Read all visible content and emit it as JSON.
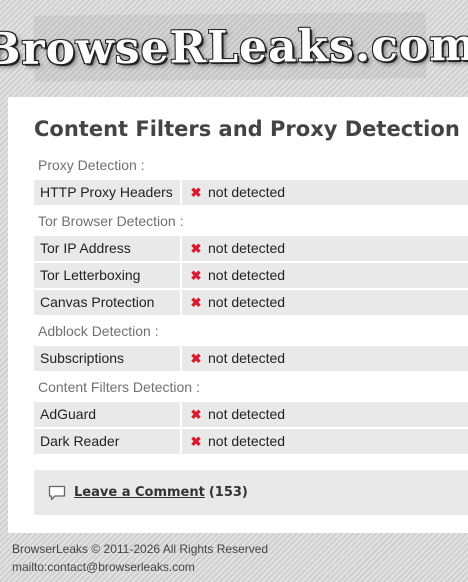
{
  "header": {
    "logo_text": "BrowseRLeaks.com"
  },
  "main": {
    "title": "Content Filters and Proxy Detection",
    "sections": [
      {
        "header": "Proxy Detection :",
        "rows": [
          {
            "label": "HTTP Proxy Headers",
            "status": "not detected"
          }
        ]
      },
      {
        "header": "Tor Browser Detection :",
        "rows": [
          {
            "label": "Tor IP Address",
            "status": "not detected"
          },
          {
            "label": "Tor Letterboxing",
            "status": "not detected"
          },
          {
            "label": "Canvas Protection",
            "status": "not detected"
          }
        ]
      },
      {
        "header": "Adblock Detection :",
        "rows": [
          {
            "label": "Subscriptions",
            "status": "not detected"
          }
        ]
      },
      {
        "header": "Content Filters Detection :",
        "rows": [
          {
            "label": "AdGuard",
            "status": "not detected"
          },
          {
            "label": "Dark Reader",
            "status": "not detected"
          }
        ]
      }
    ],
    "comment": {
      "link_label": "Leave a Comment",
      "count": "(153)"
    }
  },
  "status_icon": {
    "name": "x-icon",
    "glyph": "✖",
    "color": "#e0182b"
  },
  "footer": {
    "copyright": "BrowserLeaks © 2011-2026 All Rights Reserved",
    "contact": "mailto:contact@browserleaks.com"
  }
}
